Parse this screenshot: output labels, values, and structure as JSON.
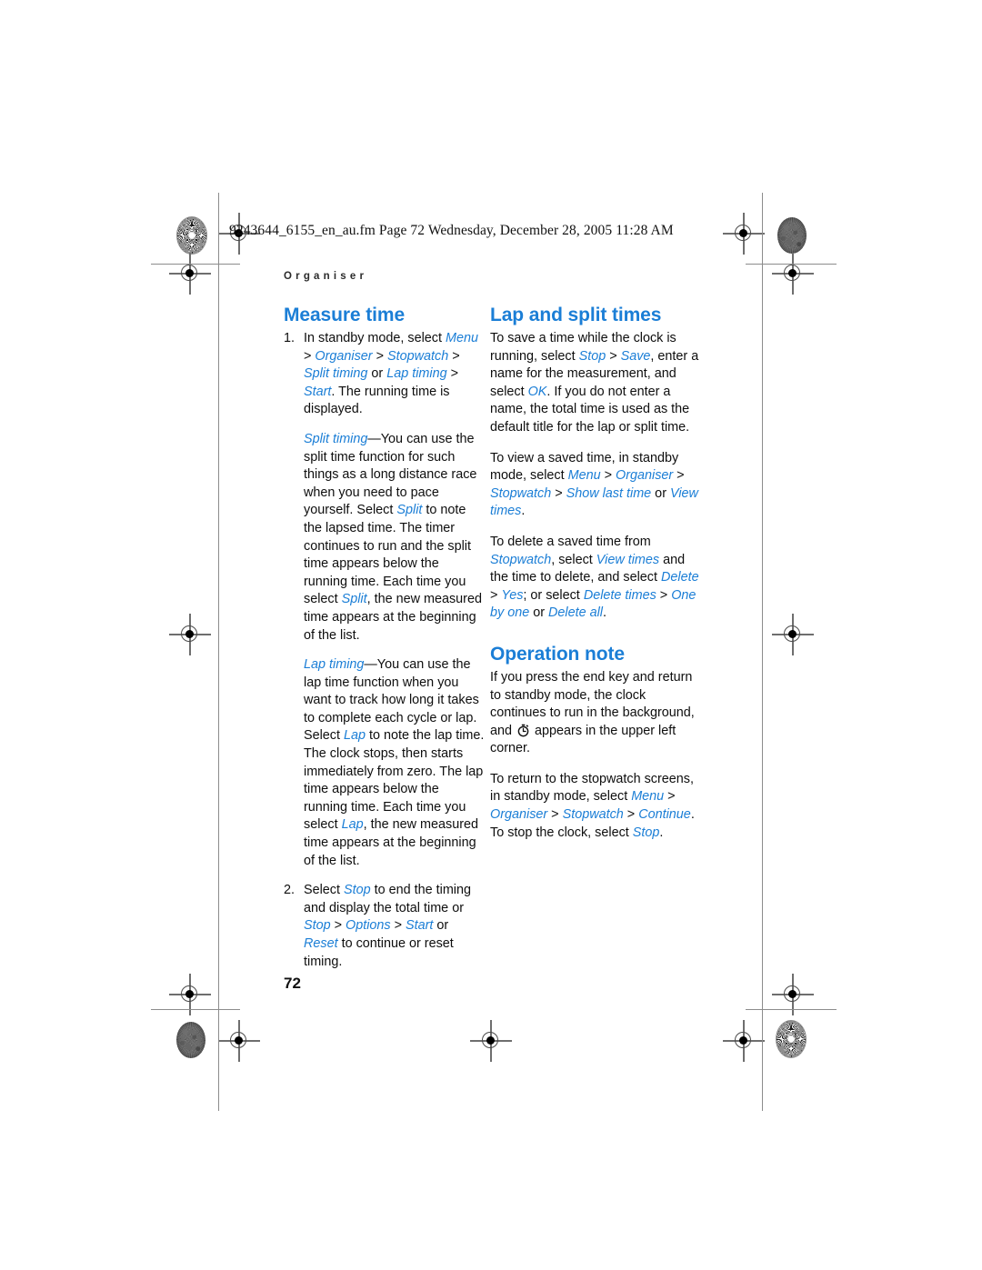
{
  "print_marks": {
    "file_header": "9243644_6155_en_au.fm  Page 72  Wednesday, December 28, 2005  11:28 AM"
  },
  "page": {
    "running_header": "Organiser",
    "page_number": "72"
  },
  "left_column": {
    "heading": "Measure time",
    "step1": {
      "number": "1.",
      "t1": "In standby mode, select ",
      "ui_menu": "Menu",
      "s1": " > ",
      "ui_organiser": "Organiser",
      "s2": " > ",
      "ui_stopwatch": "Stopwatch",
      "s3": " > ",
      "ui_split_timing": "Split timing",
      "t2": " or ",
      "ui_lap_timing": "Lap timing",
      "s4": " > ",
      "ui_start": "Start",
      "t3": ". The running time is displayed."
    },
    "split_para": {
      "ui_lead": "Split timing",
      "t1": "—You can use the split time function for such things as a long distance race when you need to pace yourself. Select ",
      "ui_split_1": "Split",
      "t2": " to note the lapsed time. The timer continues to run and the split time appears below the running time. Each time you select ",
      "ui_split_2": "Split",
      "t3": ", the new measured time appears at the beginning of the list."
    },
    "lap_para": {
      "ui_lead": "Lap timing",
      "t1": "—You can use the lap time function when you want to track how long it takes to complete each cycle or lap. Select ",
      "ui_lap_1": "Lap",
      "t2": " to note the lap time. The clock stops, then starts immediately from zero. The lap time appears below the running time. Each time you select ",
      "ui_lap_2": "Lap",
      "t3": ", the new measured time appears at the beginning of the list."
    },
    "step2": {
      "number": "2.",
      "t1": "Select ",
      "ui_stop_1": "Stop",
      "t2": " to end the timing and display the total time or ",
      "ui_stop_2": "Stop",
      "s1": " > ",
      "ui_options": "Options",
      "s2": " > ",
      "ui_start": "Start",
      "t3": " or ",
      "ui_reset": "Reset",
      "t4": " to continue or reset timing."
    }
  },
  "right_column": {
    "heading_lap_split": "Lap and split times",
    "save_para": {
      "t1": "To save a time while the clock is running, select ",
      "ui_stop": "Stop",
      "s1": " > ",
      "ui_save": "Save",
      "t2": ", enter a name for the measurement, and select ",
      "ui_ok": "OK",
      "t3": ". If you do not enter a name, the total time is used as the default title for the lap or split time."
    },
    "view_para": {
      "t1": "To view a saved time, in standby mode, select ",
      "ui_menu": "Menu",
      "s1": " > ",
      "ui_organiser": "Organiser",
      "s2": " > ",
      "ui_stopwatch": "Stopwatch",
      "s3": " > ",
      "ui_show_last_time": "Show last time",
      "t2": " or ",
      "ui_view_times": "View times",
      "t3": "."
    },
    "delete_para": {
      "t1": "To delete a saved time from ",
      "ui_stopwatch": "Stopwatch",
      "t2": ", select ",
      "ui_view_times": "View times",
      "t3": " and the time to delete, and select ",
      "ui_delete": "Delete",
      "s1": " > ",
      "ui_yes": "Yes",
      "t4": "; or select ",
      "ui_delete_times": "Delete times",
      "s2": " > ",
      "ui_one_by_one": "One by one",
      "t5": " or ",
      "ui_delete_all": "Delete all",
      "t6": "."
    },
    "heading_operation_note": "Operation note",
    "background_para": {
      "t1": "If you press the end key and return to standby mode, the clock continues to run in the background, and ",
      "icon": "stopwatch-icon",
      "t2": " appears in the upper left corner."
    },
    "return_para": {
      "t1": "To return to the stopwatch screens, in standby mode, select ",
      "ui_menu": "Menu",
      "s1": " > ",
      "ui_organiser": "Organiser",
      "s2": " > ",
      "ui_stopwatch": "Stopwatch",
      "s3": " > ",
      "ui_continue": "Continue",
      "t2": ". To stop the clock, select ",
      "ui_stop": "Stop",
      "t3": "."
    }
  },
  "colors": {
    "heading_blue": "#1b7ed6",
    "body_black": "#0e0e0e"
  }
}
